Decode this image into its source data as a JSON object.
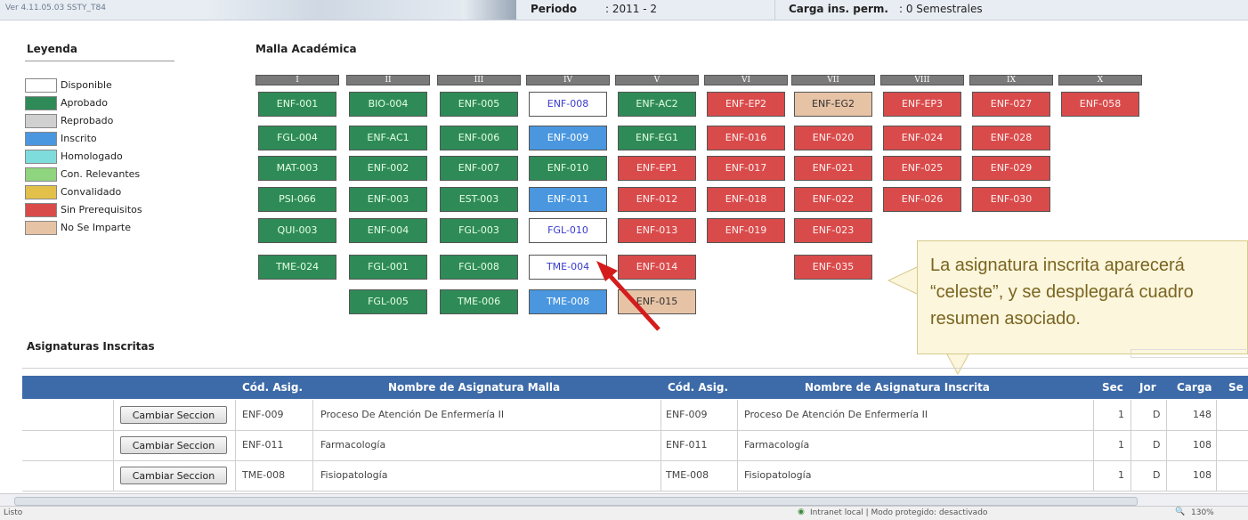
{
  "topbar": {
    "version": "Ver 4.11.05.03 SSTY_T84",
    "periodo_label": "Periodo",
    "periodo_value": ": 2011 - 2",
    "carga_label": "Carga ins. perm.",
    "carga_value": ": 0 Semestrales"
  },
  "legend": {
    "title": "Leyenda",
    "items": [
      {
        "label": "Disponible",
        "color": "#ffffff"
      },
      {
        "label": "Aprobado",
        "color": "#2e8b57"
      },
      {
        "label": "Reprobado",
        "color": "#d0d0d0"
      },
      {
        "label": "Inscrito",
        "color": "#4a97e0"
      },
      {
        "label": "Homologado",
        "color": "#7fdcdc"
      },
      {
        "label": "Con. Relevantes",
        "color": "#8fd47e"
      },
      {
        "label": "Convalidado",
        "color": "#e2c04a"
      },
      {
        "label": "Sin Prerequisitos",
        "color": "#d94b4b"
      },
      {
        "label": "No Se Imparte",
        "color": "#e7c3a6"
      }
    ]
  },
  "malla": {
    "title": "Malla Académica",
    "columns": [
      "I",
      "II",
      "III",
      "IV",
      "V",
      "VI",
      "VII",
      "VIII",
      "IX",
      "X"
    ],
    "cells": [
      [
        "ENF-001",
        "BIO-004",
        "ENF-005",
        "ENF-008",
        "ENF-AC2",
        "ENF-EP2",
        "ENF-EG2",
        "ENF-EP3",
        "ENF-027",
        "ENF-058"
      ],
      [
        "FGL-004",
        "ENF-AC1",
        "ENF-006",
        "ENF-009",
        "ENF-EG1",
        "ENF-016",
        "ENF-020",
        "ENF-024",
        "ENF-028"
      ],
      [
        "MAT-003",
        "ENF-002",
        "ENF-007",
        "ENF-010",
        "ENF-EP1",
        "ENF-017",
        "ENF-021",
        "ENF-025",
        "ENF-029"
      ],
      [
        "PSI-066",
        "ENF-003",
        "EST-003",
        "ENF-011",
        "ENF-012",
        "ENF-018",
        "ENF-022",
        "ENF-026",
        "ENF-030"
      ],
      [
        "QUI-003",
        "ENF-004",
        "FGL-003",
        "FGL-010",
        "ENF-013",
        "ENF-019",
        "ENF-023"
      ],
      [
        "TME-024",
        "FGL-001",
        "FGL-008",
        "TME-004",
        "ENF-014",
        "ENF-035"
      ],
      [
        "FGL-005",
        "TME-006",
        "TME-008",
        "ENF-015"
      ]
    ]
  },
  "callout": {
    "line1": "La asignatura inscrita aparecerá",
    "line2": "“celeste”, y se desplegará cuadro",
    "line3": "resumen asociado."
  },
  "inscritas": {
    "title": "Asignaturas Inscritas",
    "headers": {
      "cod1": "Cód. Asig.",
      "nombre_malla": "Nombre de Asignatura Malla",
      "cod2": "Cód. Asig.",
      "nombre_inscrita": "Nombre de Asignatura Inscrita",
      "sec": "Sec",
      "jor": "Jor",
      "carga": "Carga",
      "se": "Se"
    },
    "rows": [
      {
        "button": "Cambiar Seccion",
        "cod1": "ENF-009",
        "nombre_malla": "Proceso De Atención De Enfermería II",
        "cod2": "ENF-009",
        "nombre_inscrita": "Proceso De Atención De Enfermería II",
        "sec": "1",
        "jor": "D",
        "carga": "148"
      },
      {
        "button": "Cambiar Seccion",
        "cod1": "ENF-011",
        "nombre_malla": "Farmacología",
        "cod2": "ENF-011",
        "nombre_inscrita": "Farmacología",
        "sec": "1",
        "jor": "D",
        "carga": "108"
      },
      {
        "button": "Cambiar Seccion",
        "cod1": "TME-008",
        "nombre_malla": "Fisiopatología",
        "cod2": "TME-008",
        "nombre_inscrita": "Fisiopatología",
        "sec": "1",
        "jor": "D",
        "carga": "108"
      }
    ]
  },
  "statusbar": {
    "left": "Listo",
    "zone": "Intranet local | Modo protegido: desactivado",
    "zoom": "130%"
  }
}
